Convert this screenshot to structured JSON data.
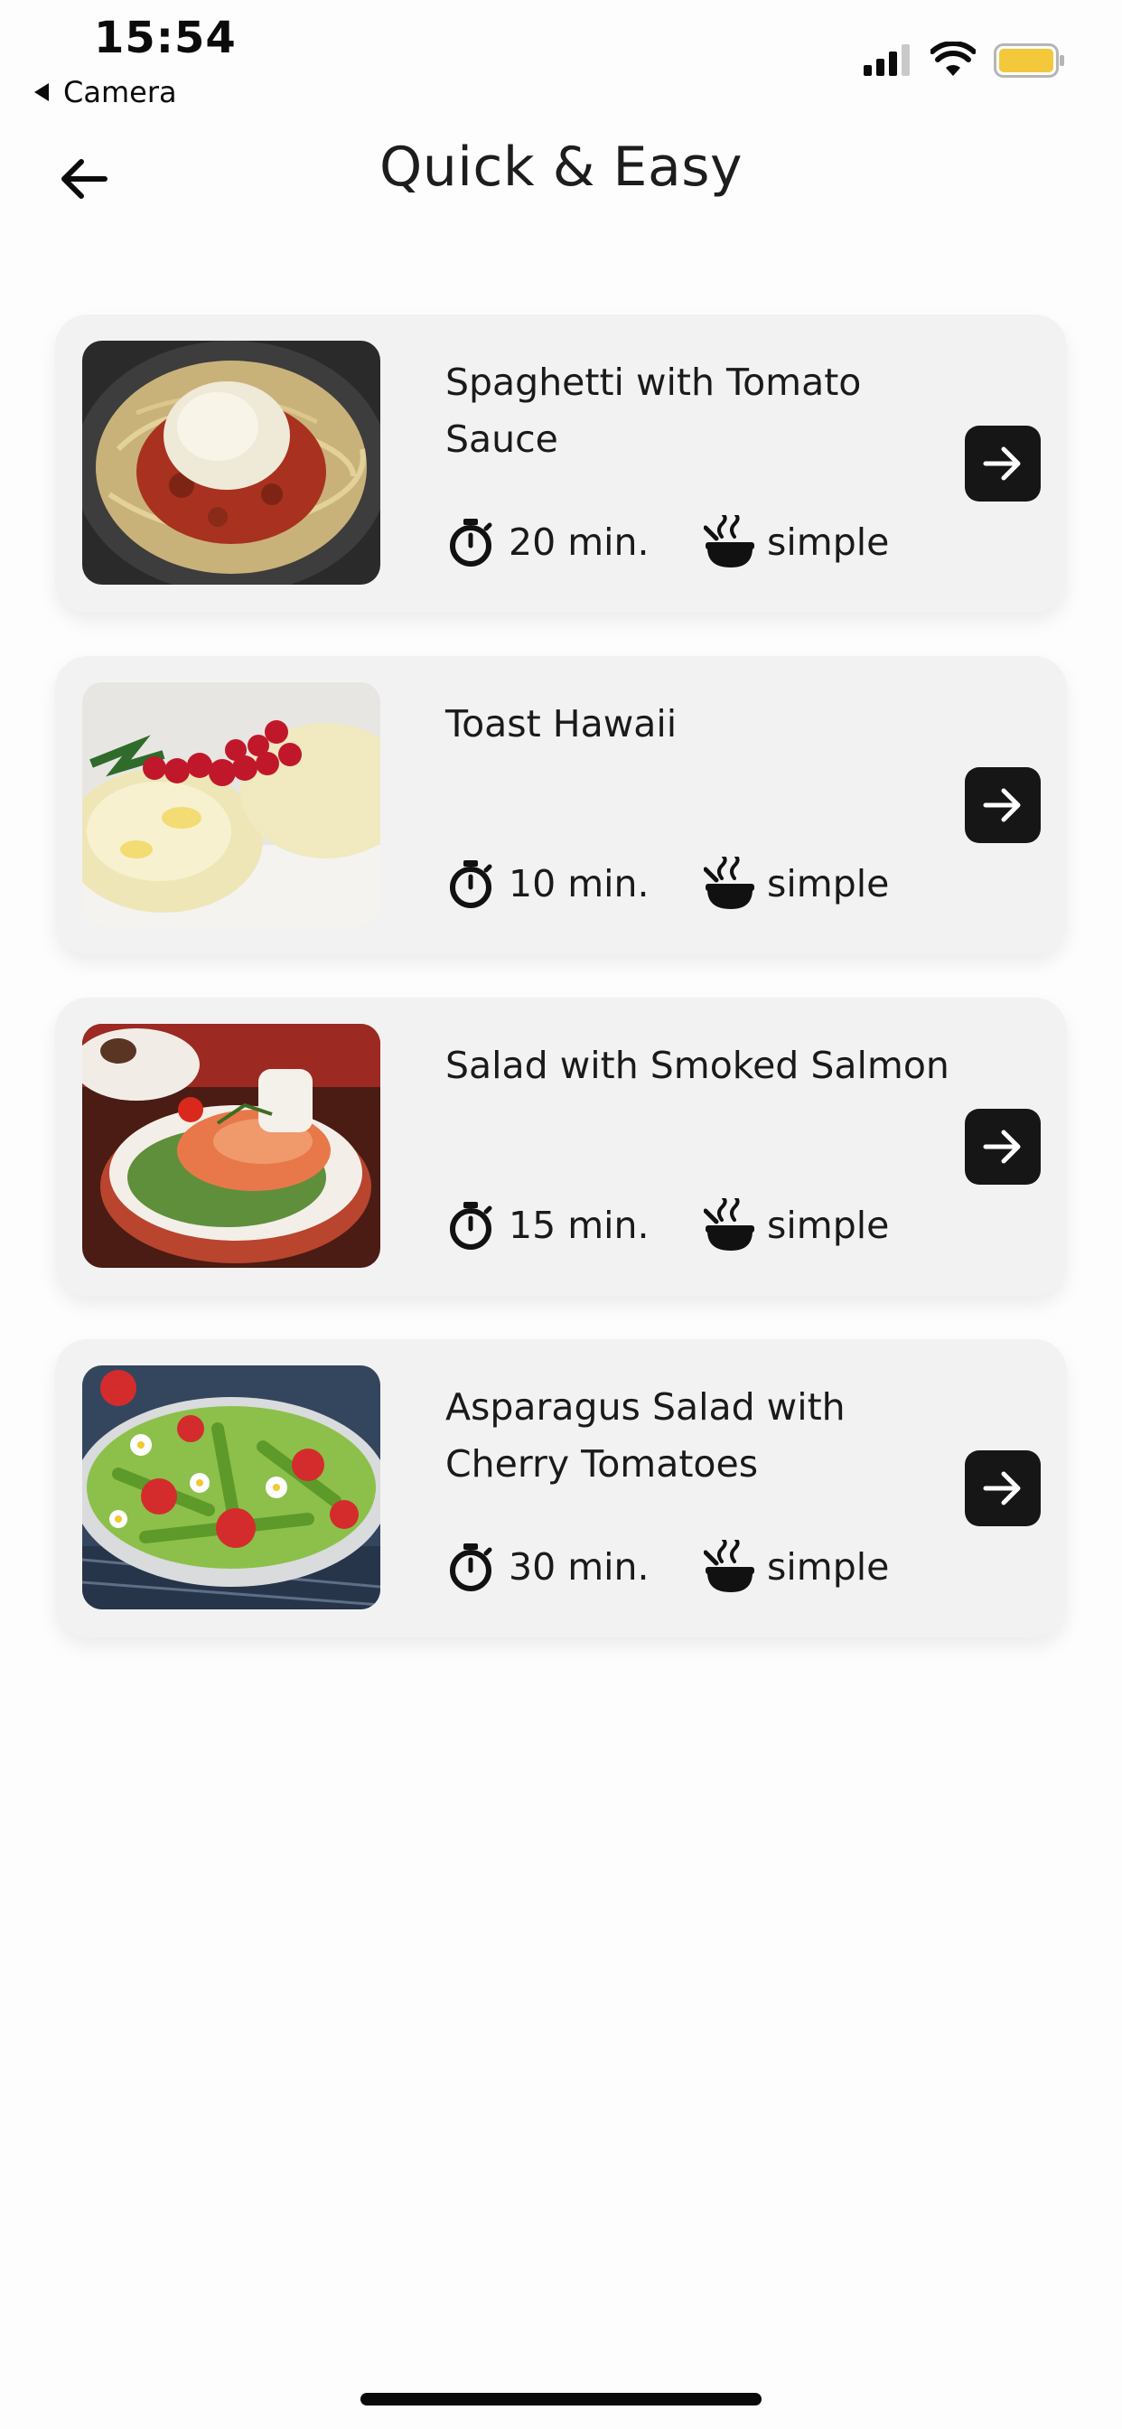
{
  "status_bar": {
    "time": "15:54",
    "back_app": "Camera",
    "battery_color": "#f3c93b"
  },
  "header": {
    "title": "Quick & Easy",
    "back_icon": "arrow-left-icon"
  },
  "recipes": [
    {
      "title": "Spaghetti with Tomato Sauce",
      "time": "20 min.",
      "difficulty": "simple",
      "image": "spaghetti-photo"
    },
    {
      "title": "Toast Hawaii",
      "time": "10 min.",
      "difficulty": "simple",
      "image": "toast-hawaii-photo"
    },
    {
      "title": "Salad with Smoked Salmon",
      "time": "15 min.",
      "difficulty": "simple",
      "image": "salmon-salad-photo"
    },
    {
      "title": "Asparagus Salad with Cherry Tomatoes",
      "time": "30 min.",
      "difficulty": "simple",
      "image": "asparagus-salad-photo"
    }
  ],
  "colors": {
    "background": "#fdfdfd",
    "card": "#f2f2f2",
    "button": "#161616",
    "text": "#1a1a1a"
  }
}
